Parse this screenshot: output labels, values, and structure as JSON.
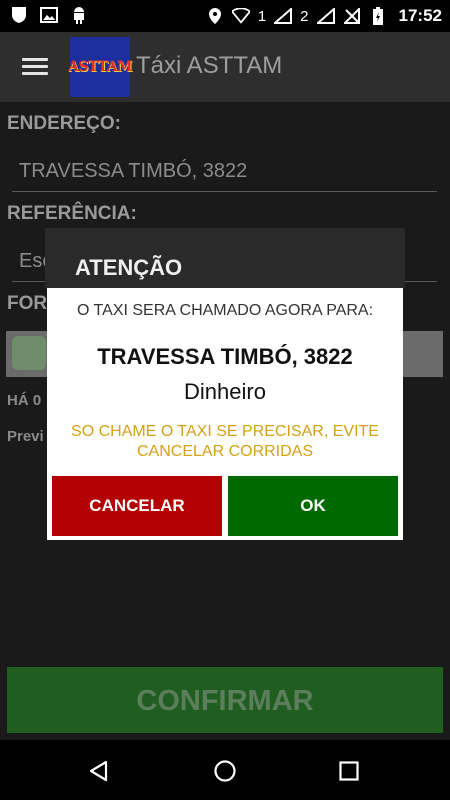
{
  "status_bar": {
    "time": "17:52",
    "sim1_label": "1",
    "sim2_label": "2"
  },
  "app_bar": {
    "title": "Táxi ASTTAM",
    "logo_text": "ASTTAM"
  },
  "form": {
    "address_label": "ENDEREÇO:",
    "address_value": "TRAVESSA TIMBÓ, 3822",
    "reference_label": "REFERÊNCIA:",
    "reference_placeholder": "Esc",
    "payment_label": "FOR",
    "info_line1": "HÁ 0",
    "info_line2": "Previ",
    "confirm_button": "CONFIRMAR"
  },
  "dialog": {
    "title": "ATENÇÃO",
    "message": "O TAXI SERA CHAMADO AGORA PARA:",
    "address": "TRAVESSA TIMBÓ, 3822",
    "payment": "Dinheiro",
    "warning": "SO CHAME O TAXI SE PRECISAR, EVITE CANCELAR CORRIDAS",
    "cancel_label": "CANCELAR",
    "ok_label": "OK"
  },
  "colors": {
    "cancel": "#b40000",
    "ok": "#006a00",
    "warning": "#d4a117",
    "confirm": "#1f5d21"
  }
}
